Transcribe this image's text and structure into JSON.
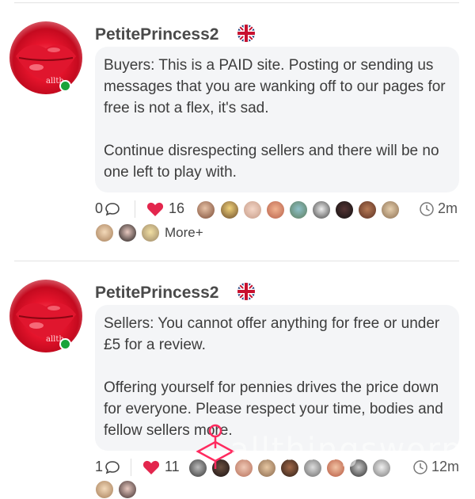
{
  "colors": {
    "heart": "#e3264d",
    "online": "#1aa33a",
    "bubble_bg": "#f4f5f7",
    "watermark_pin": "#ff2a5f"
  },
  "posts": [
    {
      "username": "PetitePrincess2",
      "flag": "uk-flag-icon",
      "avatar_watermark": "allth",
      "paragraphs": [
        "Buyers: This is a PAID site. Posting or sending us messages that you are wanking off to our pages for free is not a flex, it's sad.",
        "Continue disrespecting sellers and there will be no one left to play with."
      ],
      "comments": "0",
      "likes": "16",
      "time": "2m",
      "more": "More+"
    },
    {
      "username": "PetitePrincess2",
      "flag": "uk-flag-icon",
      "avatar_watermark": "allth",
      "paragraphs": [
        "Sellers: You cannot offer anything for free or under £5 for a review.",
        "Offering yourself for pennies drives the price down for everyone. Please respect your time, bodies and fellow sellers more."
      ],
      "comments": "1",
      "likes": "11",
      "time": "12m"
    }
  ],
  "watermark": "allthingsworn"
}
